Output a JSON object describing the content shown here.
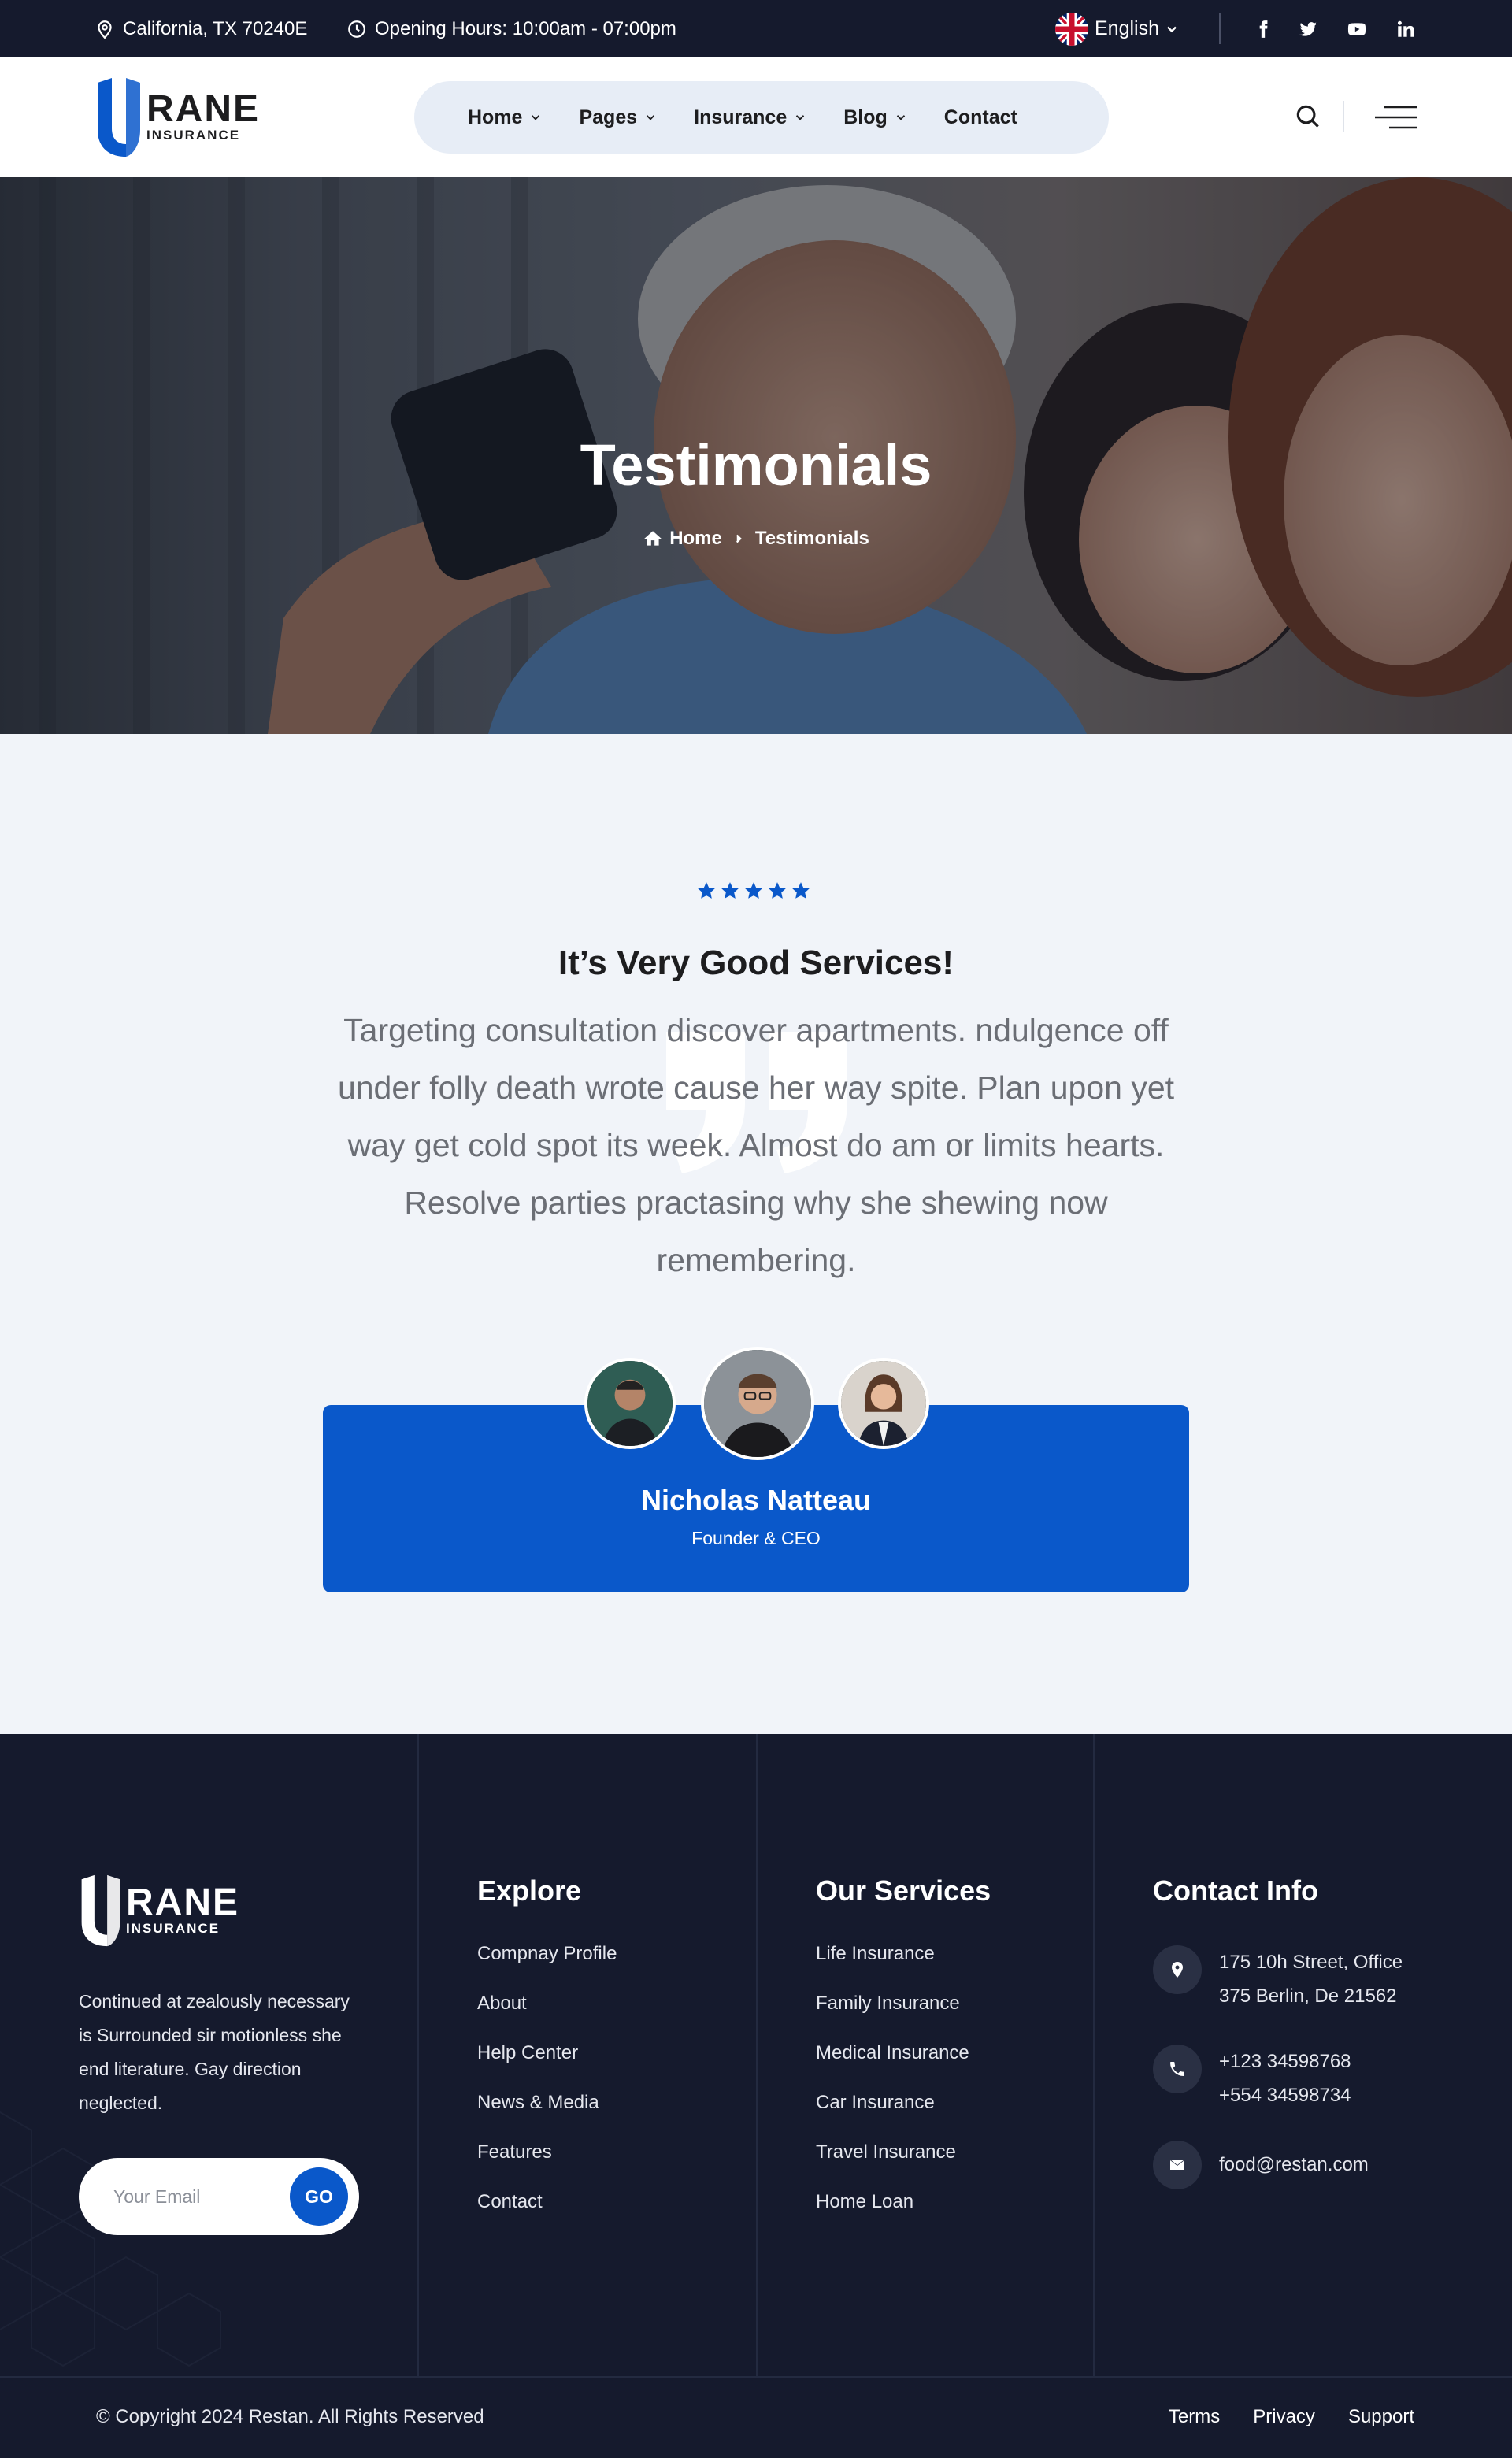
{
  "topbar": {
    "location": "California, TX 70240E",
    "hours": "Opening Hours: 10:00am - 07:00pm",
    "language": "English",
    "social": [
      "facebook-icon",
      "twitter-icon",
      "youtube-icon",
      "linkedin-icon"
    ]
  },
  "brand": {
    "name": "RANE",
    "tagline": "INSURANCE",
    "color": "#0a58ca",
    "dark": "#151a2d"
  },
  "nav": {
    "items": [
      {
        "label": "Home"
      },
      {
        "label": "Pages"
      },
      {
        "label": "Insurance"
      },
      {
        "label": "Blog"
      },
      {
        "label": "Contact"
      }
    ]
  },
  "hero": {
    "title": "Testimonials",
    "breadcrumb": {
      "home": "Home",
      "current": "Testimonials"
    }
  },
  "testimonial": {
    "rating": 5,
    "heading": "It’s Very Good Services!",
    "quote": "Targeting consultation discover apartments. ndulgence off under folly death wrote cause her way spite. Plan upon yet way get cold spot its week. Almost do am or limits hearts. Resolve parties practasing why she shewing now remembering.",
    "author": "Nicholas Natteau",
    "role": "Founder & CEO"
  },
  "footer": {
    "about": "Continued at zealously necessary is Surrounded sir motionless she end literature. Gay direction neglected.",
    "email_placeholder": "Your Email",
    "go_label": "GO",
    "explore": {
      "title": "Explore",
      "links": [
        "Compnay Profile",
        "About",
        "Help Center",
        "News & Media",
        "Features",
        "Contact"
      ]
    },
    "services": {
      "title": "Our Services",
      "links": [
        "Life Insurance",
        "Family Insurance",
        "Medical Insurance",
        "Car Insurance",
        "Travel Insurance",
        "Home Loan"
      ]
    },
    "contact": {
      "title": "Contact Info",
      "address_1": "175 10h Street, Office",
      "address_2": "375 Berlin, De 21562",
      "phone_1": "+123 34598768",
      "phone_2": "+554 34598734",
      "email": "food@restan.com"
    },
    "copyright": "© Copyright 2024 Restan. All Rights Reserved",
    "bottom_links": [
      "Terms",
      "Privacy",
      "Support"
    ]
  }
}
